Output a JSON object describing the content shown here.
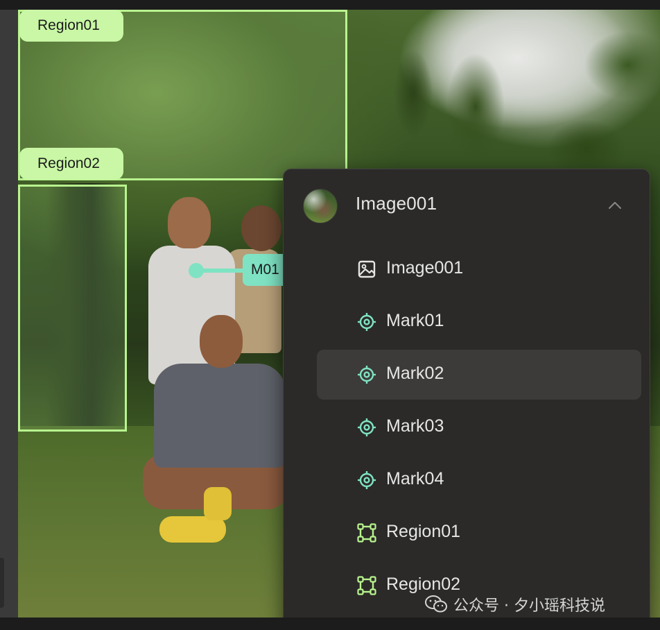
{
  "canvas": {
    "regions": [
      {
        "label": "Region01"
      },
      {
        "label": "Region02"
      }
    ],
    "mark_label": "M01"
  },
  "panel": {
    "title": "Image001",
    "expanded": true,
    "items": [
      {
        "label": "Image001",
        "icon": "image-icon"
      },
      {
        "label": "Mark01",
        "icon": "target-icon"
      },
      {
        "label": "Mark02",
        "icon": "target-icon",
        "selected": true
      },
      {
        "label": "Mark03",
        "icon": "target-icon"
      },
      {
        "label": "Mark04",
        "icon": "target-icon"
      },
      {
        "label": "Region01",
        "icon": "region-icon"
      },
      {
        "label": "Region02",
        "icon": "region-icon"
      }
    ]
  },
  "watermark": {
    "text": "公众号 · 夕小瑶科技说"
  },
  "colors": {
    "region": "#b9f58f",
    "region_label_bg": "#c9f7a5",
    "mark": "#7fe3c3",
    "panel_bg": "#2b2a28",
    "selected_bg": "#3c3b39"
  }
}
